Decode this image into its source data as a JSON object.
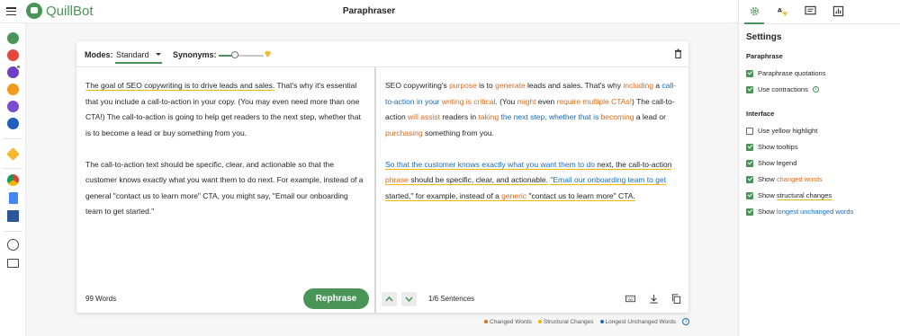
{
  "app": {
    "name": "QuillBot",
    "page_title": "Paraphraser"
  },
  "toolbar": {
    "modes_label": "Modes:",
    "mode_selected": "Standard",
    "synonyms_label": "Synonyms:",
    "synonyms_level": 0.35
  },
  "input": {
    "paragraphs": [
      {
        "segments": [
          {
            "text": "The goal of SEO copywriting is to drive leads and sales.",
            "underline": true
          },
          {
            "text": " That's why it's essential that you include a call-to-action in your copy. (You may even need more than one CTA!) The call-to-action is going to help get readers to the next step, whether that is to become a lead or buy something from you."
          }
        ]
      },
      {
        "segments": [
          {
            "text": "The call-to-action text should be specific, clear, and actionable so that the customer knows exactly what you want them to do next. For example, instead of a general \"contact us to learn more\" CTA, you might say, \"Email our onboarding team to get started.\""
          }
        ]
      }
    ],
    "word_count": "99 Words",
    "rephrase_label": "Rephrase"
  },
  "output": {
    "paragraphs": [
      {
        "segments": [
          {
            "text": "SEO copywriting's "
          },
          {
            "text": "purpose",
            "type": "changed"
          },
          {
            "text": " is to "
          },
          {
            "text": "generate",
            "type": "changed"
          },
          {
            "text": " leads and sales. That's why "
          },
          {
            "text": "including",
            "type": "changed"
          },
          {
            "text": " a "
          },
          {
            "text": "call-to-action in your",
            "type": "longest"
          },
          {
            "text": " "
          },
          {
            "text": "writing is critical",
            "type": "changed"
          },
          {
            "text": ". (You "
          },
          {
            "text": "might",
            "type": "changed"
          },
          {
            "text": " even "
          },
          {
            "text": "require multiple CTAs!",
            "type": "changed"
          },
          {
            "text": ") The call-to-action "
          },
          {
            "text": "will assist",
            "type": "changed"
          },
          {
            "text": " readers in "
          },
          {
            "text": "taking",
            "type": "changed"
          },
          {
            "text": " "
          },
          {
            "text": "the next step, whether that is",
            "type": "longest"
          },
          {
            "text": " "
          },
          {
            "text": "becoming",
            "type": "changed"
          },
          {
            "text": " a lead or "
          },
          {
            "text": "purchasing",
            "type": "changed"
          },
          {
            "text": " something from you."
          }
        ]
      },
      {
        "segments": [
          {
            "text": "So that the customer knows exactly what you want them to do",
            "type": "longest",
            "structural": true
          },
          {
            "text": " next, the call-to-action ",
            "structural": true
          },
          {
            "text": "phrase",
            "type": "changed",
            "structural": true
          },
          {
            "text": " should be specific, clear, and actionable.",
            "structural": true
          },
          {
            "text": " "
          },
          {
            "text": "\"Email our onboarding team to get",
            "type": "longest",
            "structural": true
          },
          {
            "text": " started,\" for example, instead of a ",
            "structural": true
          },
          {
            "text": "generic",
            "type": "changed",
            "structural": true
          },
          {
            "text": " \"contact us to learn more\" CTA.",
            "structural": true
          }
        ]
      }
    ],
    "sentence_count": "1/6 Sentences"
  },
  "legend": {
    "changed": "Changed Words",
    "structural": "Structural Changes",
    "longest": "Longest Unchanged Words"
  },
  "settings": {
    "title": "Settings",
    "paraphrase_section": "Paraphrase",
    "paraphrase_options": [
      {
        "label": "Paraphrase quotations",
        "checked": true
      },
      {
        "label": "Use contractions",
        "checked": true,
        "info": true
      }
    ],
    "interface_section": "Interface",
    "interface_options": [
      {
        "label": "Use yellow highlight",
        "checked": false
      },
      {
        "label": "Show tooltips",
        "checked": true
      },
      {
        "label": "Show legend",
        "checked": true
      },
      {
        "label_prefix": "Show ",
        "label_accent": "changed words",
        "accent": "changed",
        "checked": true
      },
      {
        "label_prefix": "Show ",
        "label_accent": "structural changes",
        "accent": "structural",
        "checked": true
      },
      {
        "label_prefix": "Show ",
        "label_accent": "longest unchanged words",
        "accent": "longest",
        "checked": true
      }
    ]
  },
  "colors": {
    "brand": "#499557",
    "changed": "#e06a1c",
    "structural": "#f2b705",
    "longest": "#1a6bbf"
  },
  "icons": {
    "rail": [
      "paraphraser-icon",
      "grammar-checker-icon",
      "plagiarism-checker-icon",
      "co-writer-icon",
      "summarizer-icon",
      "citation-generator-icon",
      "premium-icon",
      "chrome-extension-icon",
      "google-docs-icon",
      "word-icon",
      "help-icon",
      "mail-icon"
    ],
    "side_tabs": [
      "settings-gear-icon",
      "translate-icon",
      "comments-icon",
      "statistics-icon"
    ]
  }
}
